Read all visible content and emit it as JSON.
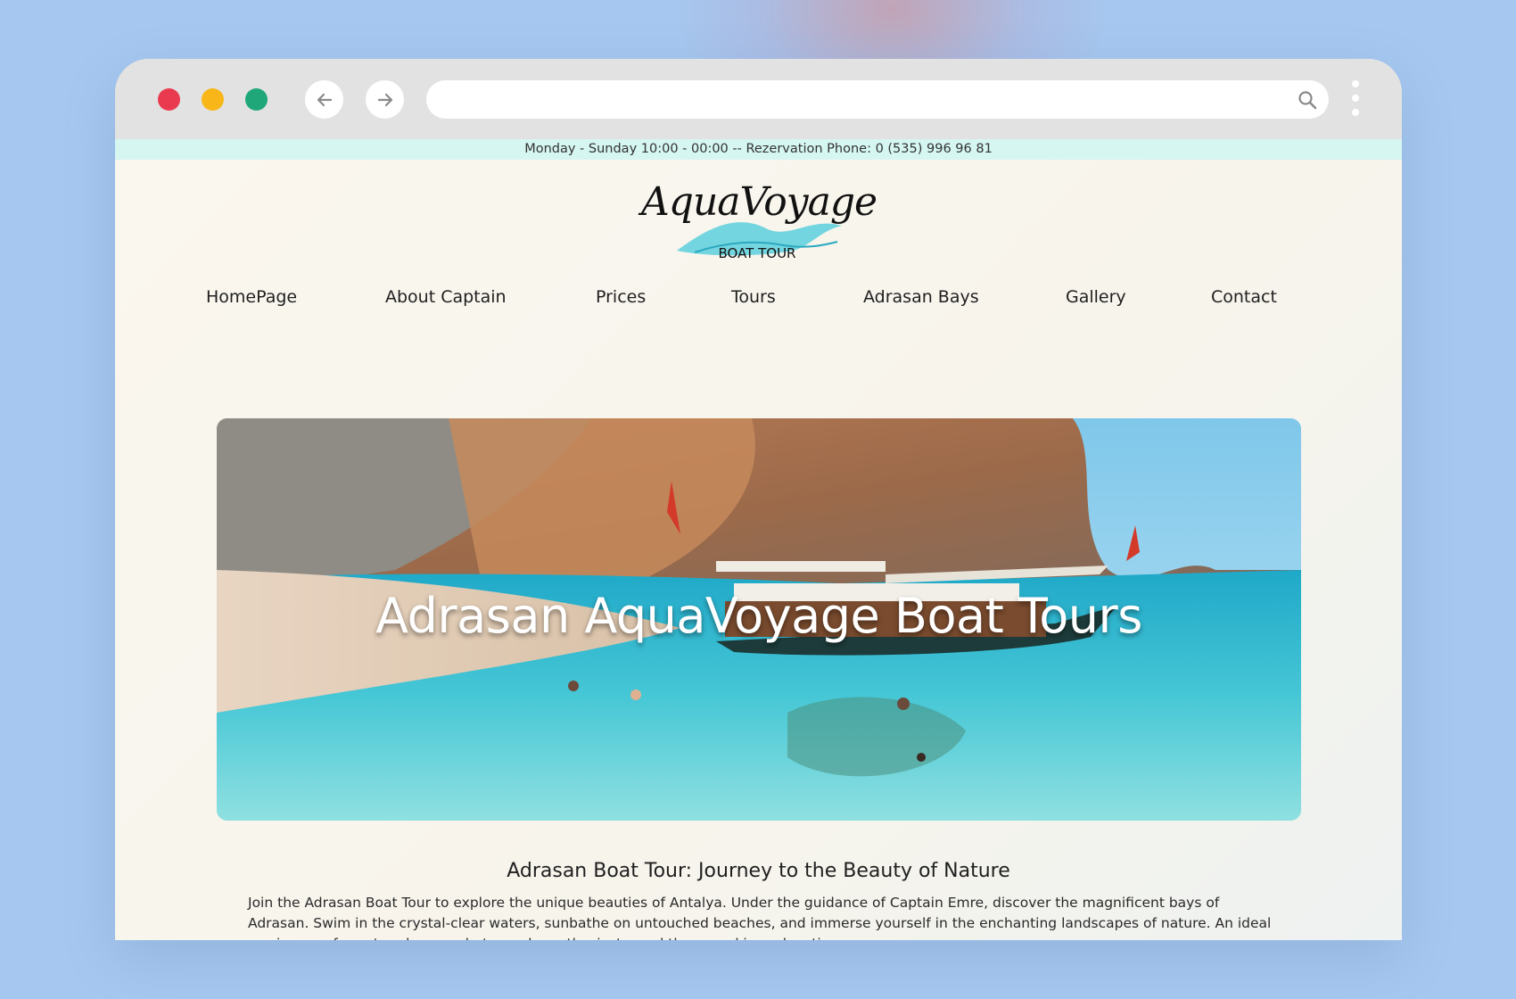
{
  "browser": {
    "url": "",
    "icons": [
      "arrow-left-icon",
      "arrow-right-icon",
      "search-icon",
      "kebab-menu-icon"
    ]
  },
  "site": {
    "info_bar": "Monday - Sunday 10:00 - 00:00 -- Rezervation Phone: 0 (535) 996 96 81",
    "logo": {
      "script": "AquaVoyage",
      "sub": "BOAT TOUR"
    },
    "nav": [
      {
        "label": "HomePage"
      },
      {
        "label": "About Captain"
      },
      {
        "label": "Prices"
      },
      {
        "label": "Tours"
      },
      {
        "label": "Adrasan Bays"
      },
      {
        "label": "Gallery"
      },
      {
        "label": "Contact"
      }
    ],
    "hero": {
      "title": "Adrasan AquaVoyage Boat Tours"
    },
    "section": {
      "title": "Adrasan Boat Tour: Journey to the Beauty of Nature",
      "body": "Join the Adrasan Boat Tour to explore the unique beauties of Antalya. Under the guidance of Captain Emre, discover the magnificent bays of Adrasan. Swim in the crystal-clear waters, sunbathe on untouched beaches, and immerse yourself in the enchanting landscapes of nature. An ideal sea journey for nature lovers, photography enthusiasts, and those seeking relaxation."
    }
  },
  "colors": {
    "close": "#ea3a4f",
    "minimize": "#f8b618",
    "maximize": "#1fa77a",
    "info_bar_bg": "#d5f6f1",
    "page_bg": "#f8f5ee"
  }
}
